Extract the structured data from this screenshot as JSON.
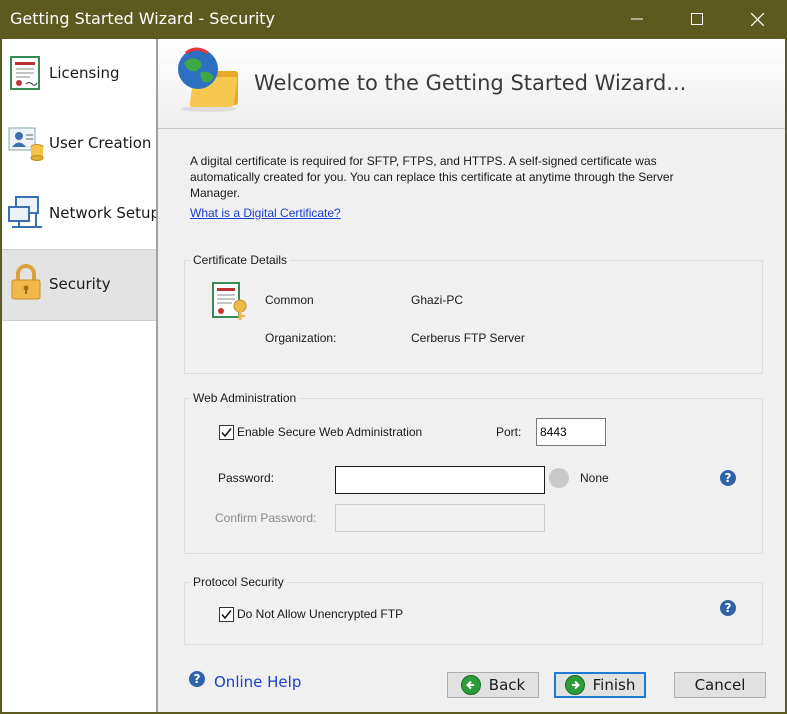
{
  "window": {
    "title": "Getting Started Wizard - Security",
    "minimize_icon": "minimize-icon",
    "maximize_icon": "maximize-icon",
    "close_icon": "close-icon"
  },
  "sidebar": {
    "items": [
      {
        "label": "Licensing",
        "icon": "certificate-icon",
        "selected": false
      },
      {
        "label": "User Creation",
        "icon": "user-database-icon",
        "selected": false
      },
      {
        "label": "Network Setup",
        "icon": "network-icon",
        "selected": false
      },
      {
        "label": "Security",
        "icon": "lock-icon",
        "selected": true
      }
    ]
  },
  "banner": {
    "title": "Welcome to the Getting Started Wizard...",
    "icon": "globe-folder-icon"
  },
  "intro": {
    "line1": "A digital certificate is required for SFTP, FTPS, and HTTPS.  A self-signed certificate was",
    "line2": "automatically created for you.  You can replace this certificate at anytime through the Server",
    "line3": "Manager.",
    "link": "What is a Digital Certificate?"
  },
  "certificate": {
    "group_label": "Certificate Details",
    "common_label": "Common",
    "common_value": "Ghazi-PC",
    "org_label": "Organization:",
    "org_value": "Cerberus FTP Server",
    "icon": "certificate-icon"
  },
  "web_admin": {
    "group_label": "Web Administration",
    "enable_label": "Enable Secure Web Administration",
    "enable_checked": true,
    "port_label": "Port:",
    "port_value": "8443",
    "password_label": "Password:",
    "password_value": "",
    "strength_label": "None",
    "confirm_label": "Confirm Password:",
    "confirm_value": ""
  },
  "protocol": {
    "group_label": "Protocol Security",
    "unencrypted_label": "Do Not Allow Unencrypted FTP",
    "unencrypted_checked": true
  },
  "footer": {
    "help_label": "Online Help",
    "back_label": "Back",
    "finish_label": "Finish",
    "cancel_label": "Cancel"
  },
  "colors": {
    "titlebar": "#5c5a1f",
    "link": "#1a3fd0",
    "help_icon": "#2f63a8",
    "default_button_border": "#1e7bd4",
    "nav_arrow_icon": "#2e9b3a"
  }
}
